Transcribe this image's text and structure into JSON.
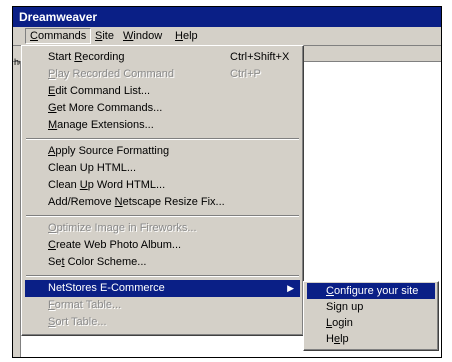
{
  "window": {
    "title": "Dreamweaver"
  },
  "menubar": [
    {
      "pre": "",
      "u": "C",
      "post": "ommands"
    },
    {
      "pre": "",
      "u": "S",
      "post": "ite"
    },
    {
      "pre": "",
      "u": "W",
      "post": "indow"
    },
    {
      "pre": "",
      "u": "H",
      "post": "elp"
    }
  ],
  "side_fragment": "he",
  "commands_menu": [
    {
      "pre": "Start ",
      "u": "R",
      "post": "ecording",
      "shortcut": "Ctrl+Shift+X"
    },
    {
      "pre": "",
      "u": "P",
      "post": "lay Recorded Command",
      "shortcut": "Ctrl+P"
    },
    {
      "pre": "",
      "u": "E",
      "post": "dit Command List..."
    },
    {
      "pre": "",
      "u": "G",
      "post": "et More Commands..."
    },
    {
      "pre": "",
      "u": "M",
      "post": "anage Extensions..."
    },
    {
      "pre": "",
      "u": "A",
      "post": "pply Source Formatting"
    },
    {
      "pre": "Clean Up ",
      "u": "",
      "post": "HTML..."
    },
    {
      "pre": "Clean ",
      "u": "U",
      "post": "p Word HTML..."
    },
    {
      "pre": "Add/Remove ",
      "u": "N",
      "post": "etscape Resize Fix..."
    },
    {
      "pre": "",
      "u": "O",
      "post": "ptimize Image in Fireworks..."
    },
    {
      "pre": "",
      "u": "C",
      "post": "reate Web Photo Album..."
    },
    {
      "pre": "Se",
      "u": "t",
      "post": " Color Scheme..."
    },
    {
      "pre": "NetStores E-Commerce",
      "u": "",
      "post": ""
    },
    {
      "pre": "",
      "u": "F",
      "post": "ormat Table..."
    },
    {
      "pre": "",
      "u": "S",
      "post": "ort Table..."
    }
  ],
  "submenu": [
    {
      "pre": "",
      "u": "C",
      "post": "onfigure your site"
    },
    {
      "pre": "Sign up",
      "u": "",
      "post": ""
    },
    {
      "pre": "",
      "u": "L",
      "post": "ogin"
    },
    {
      "pre": "H",
      "u": "e",
      "post": "lp"
    }
  ]
}
